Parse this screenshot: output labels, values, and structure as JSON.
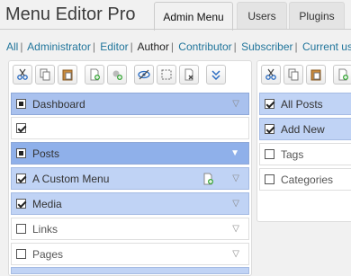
{
  "app": {
    "title": "Menu Editor Pro"
  },
  "tabs": [
    {
      "label": "Admin Menu",
      "active": true
    },
    {
      "label": "Users",
      "active": false
    },
    {
      "label": "Plugins",
      "active": false
    }
  ],
  "filters": {
    "items": [
      "All",
      "Administrator",
      "Editor",
      "Author",
      "Contributor",
      "Subscriber",
      "Current user"
    ],
    "selected": "Author"
  },
  "left_toolbar": [
    "cut-icon",
    "copy-icon",
    "paste-icon",
    "new-page-icon",
    "new-separator-icon",
    "hide-icon",
    "select-all-icon",
    "delete-icon",
    "expand-icon"
  ],
  "left_menu": [
    {
      "label": "Dashboard",
      "type": "separator-item"
    },
    {
      "label": "",
      "type": "separator"
    },
    {
      "label": "Posts",
      "type": "item"
    },
    {
      "label": "A Custom Menu",
      "type": "item"
    },
    {
      "label": "Media",
      "type": "item"
    },
    {
      "label": "Links",
      "type": "item"
    },
    {
      "label": "Pages",
      "type": "item"
    }
  ],
  "right_toolbar": [
    "cut-icon",
    "copy-icon",
    "paste-icon",
    "new-page-icon"
  ],
  "right_menu": [
    {
      "label": "All Posts",
      "checked": true
    },
    {
      "label": "Add New",
      "checked": true
    },
    {
      "label": "Tags",
      "checked": false
    },
    {
      "label": "Categories",
      "checked": false
    }
  ],
  "colors": {
    "selected": "#a9c1ee",
    "sub": "#c0d3f5",
    "link": "#21759b"
  }
}
